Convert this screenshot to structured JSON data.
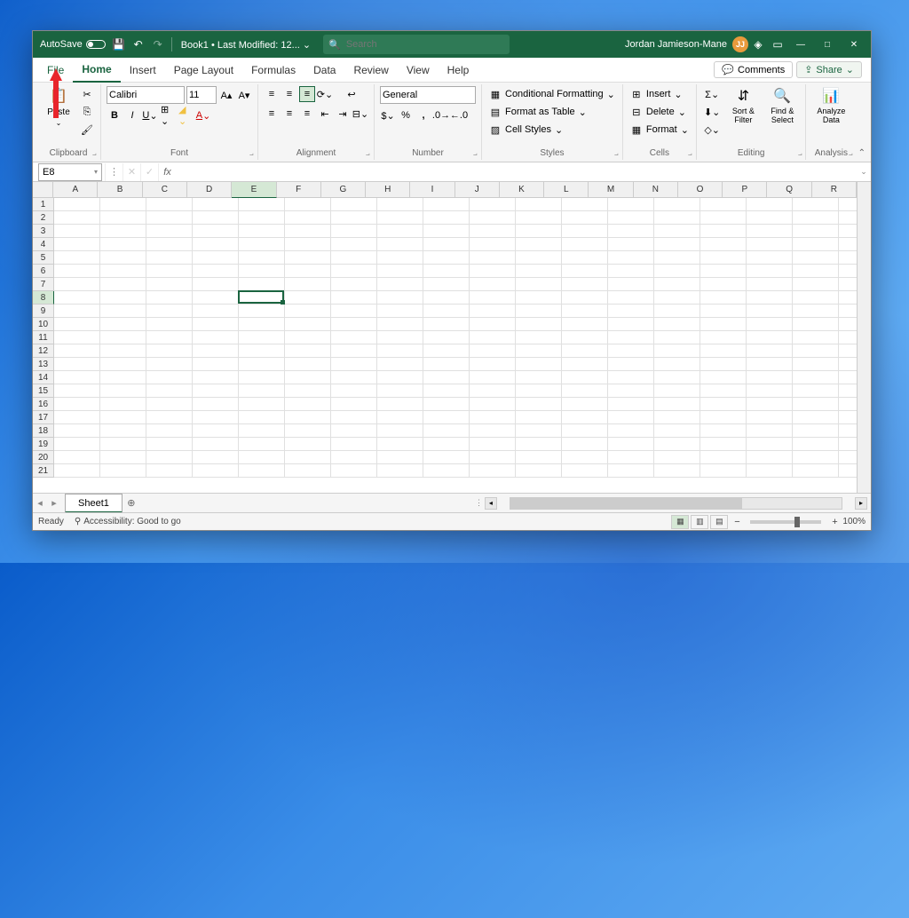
{
  "titlebar": {
    "autosave_label": "AutoSave",
    "doc_title": "Book1",
    "last_mod": "Last Modified: 12...",
    "search_placeholder": "Search",
    "user_name": "Jordan Jamieson-Mane",
    "user_initials": "JJ"
  },
  "tabs": {
    "file": "File",
    "list": [
      "Home",
      "Insert",
      "Page Layout",
      "Formulas",
      "Data",
      "Review",
      "View",
      "Help"
    ],
    "active": "Home",
    "comments": "Comments",
    "share": "Share"
  },
  "ribbon": {
    "clipboard": {
      "paste": "Paste",
      "label": "Clipboard"
    },
    "font": {
      "name": "Calibri",
      "size": "11",
      "label": "Font"
    },
    "alignment": {
      "label": "Alignment"
    },
    "number": {
      "format": "General",
      "label": "Number"
    },
    "styles": {
      "cond": "Conditional Formatting",
      "table": "Format as Table",
      "cell": "Cell Styles",
      "label": "Styles"
    },
    "cells": {
      "insert": "Insert",
      "delete": "Delete",
      "format": "Format",
      "label": "Cells"
    },
    "editing": {
      "sort": "Sort & Filter",
      "find": "Find & Select",
      "label": "Editing"
    },
    "analysis": {
      "analyze": "Analyze Data",
      "label": "Analysis"
    }
  },
  "formulabar": {
    "name_box": "E8"
  },
  "grid": {
    "columns": [
      "A",
      "B",
      "C",
      "D",
      "E",
      "F",
      "G",
      "H",
      "I",
      "J",
      "K",
      "L",
      "M",
      "N",
      "O",
      "P",
      "Q",
      "R"
    ],
    "rows": [
      "1",
      "2",
      "3",
      "4",
      "5",
      "6",
      "7",
      "8",
      "9",
      "10",
      "11",
      "12",
      "13",
      "14",
      "15",
      "16",
      "17",
      "18",
      "19",
      "20",
      "21"
    ],
    "selected_col": "E",
    "selected_row": "8"
  },
  "sheets": {
    "active": "Sheet1"
  },
  "statusbar": {
    "ready": "Ready",
    "accessibility": "Accessibility: Good to go",
    "zoom": "100%"
  }
}
